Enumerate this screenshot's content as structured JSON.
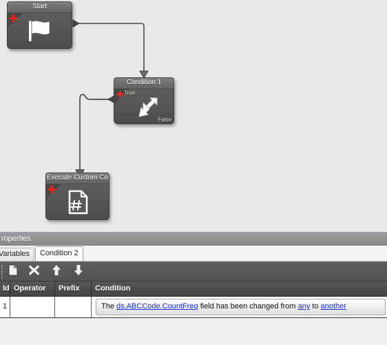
{
  "canvas": {
    "background_color": "#e8e8e8",
    "nodes": [
      {
        "id": "start",
        "title": "Start",
        "icon": "flag-icon",
        "badge": "plus-icon",
        "ports": []
      },
      {
        "id": "condition1",
        "title": "Condition 1",
        "icon": "branch-arrows-icon",
        "badge": "plus-icon",
        "ports": [
          {
            "name": "true",
            "label": "True"
          },
          {
            "name": "false",
            "label": "False"
          }
        ]
      },
      {
        "id": "execute-custom-code",
        "title": "Execute Custom Co",
        "icon": "code-document-icon",
        "badge": "plus-icon",
        "ports": []
      }
    ],
    "connectors": [
      {
        "from": "start",
        "to": "condition1"
      },
      {
        "from": "condition1",
        "to": "execute-custom-code"
      }
    ]
  },
  "panel": {
    "header_title": "roperties",
    "tabs": [
      {
        "id": "variables",
        "label": "Variables",
        "active": false
      },
      {
        "id": "condition2",
        "label": "Condition 2",
        "active": true
      }
    ],
    "toolbar": {
      "buttons": [
        {
          "id": "new",
          "icon": "new-document-icon",
          "label": "New"
        },
        {
          "id": "delete",
          "icon": "delete-x-icon",
          "label": "Delete"
        },
        {
          "id": "move-up",
          "icon": "arrow-up-icon",
          "label": "Move Up"
        },
        {
          "id": "move-down",
          "icon": "arrow-down-icon",
          "label": "Move Down"
        }
      ]
    },
    "grid": {
      "columns": [
        {
          "key": "id",
          "label": "ld"
        },
        {
          "key": "operator",
          "label": "Operator"
        },
        {
          "key": "prefix",
          "label": "Prefix"
        },
        {
          "key": "condition",
          "label": "Condition"
        }
      ],
      "rows": [
        {
          "id": "1",
          "operator": "",
          "prefix": "",
          "condition": {
            "segments": [
              {
                "text": "The ",
                "type": "text"
              },
              {
                "text": "ds.ABCCode.CountFreq",
                "type": "link"
              },
              {
                "text": " field has been changed from ",
                "type": "text"
              },
              {
                "text": "any",
                "type": "link"
              },
              {
                "text": " to ",
                "type": "text"
              },
              {
                "text": "another",
                "type": "link"
              }
            ]
          }
        }
      ]
    }
  },
  "colors": {
    "canvas": "#e8e8e8",
    "node_title": "#6e6e6e",
    "node_body": "#545454",
    "badge_red": "#e8251f",
    "toolbar": "#585858",
    "grid_header": "#4e4e4e",
    "link_blue": "#1a32d2"
  }
}
